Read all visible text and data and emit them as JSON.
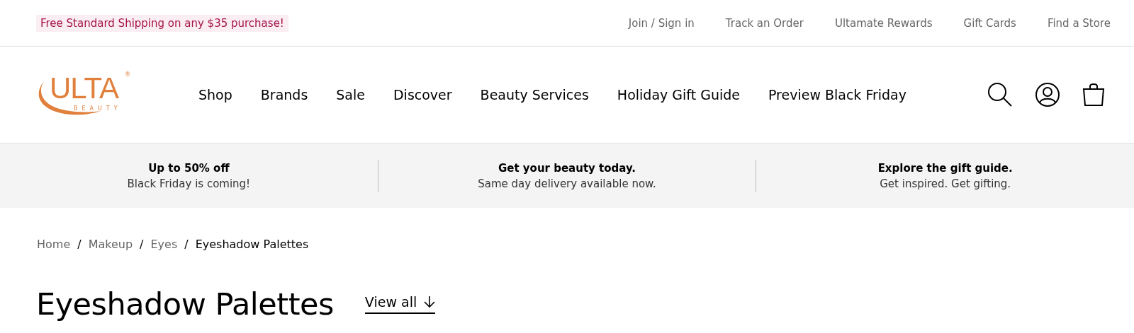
{
  "top_bar": {
    "promo": "Free Standard Shipping on any $35 purchase!",
    "links": [
      "Join / Sign in",
      "Track an Order",
      "Ultamate Rewards",
      "Gift Cards",
      "Find a Store"
    ]
  },
  "header": {
    "logo": {
      "name": "ULTA",
      "sub": "BEAUTY",
      "mark": "®"
    },
    "nav": [
      "Shop",
      "Brands",
      "Sale",
      "Discover",
      "Beauty Services",
      "Holiday Gift Guide",
      "Preview Black Friday"
    ]
  },
  "promo_band": [
    {
      "title": "Up to 50% off",
      "text": "Black Friday is coming!"
    },
    {
      "title": "Get your beauty today.",
      "text": "Same day delivery available now."
    },
    {
      "title": "Explore the gift guide.",
      "text": "Get inspired. Get gifting."
    }
  ],
  "breadcrumb": [
    {
      "label": "Home",
      "separator": "/",
      "selected": false
    },
    {
      "label": "Makeup",
      "separator": "/",
      "selected": false
    },
    {
      "label": "Eyes",
      "separator": "/",
      "selected": false
    },
    {
      "label": "Eyeshadow Palettes",
      "selected": true
    }
  ],
  "page": {
    "title": "Eyeshadow Palettes",
    "view_all": "View all"
  }
}
